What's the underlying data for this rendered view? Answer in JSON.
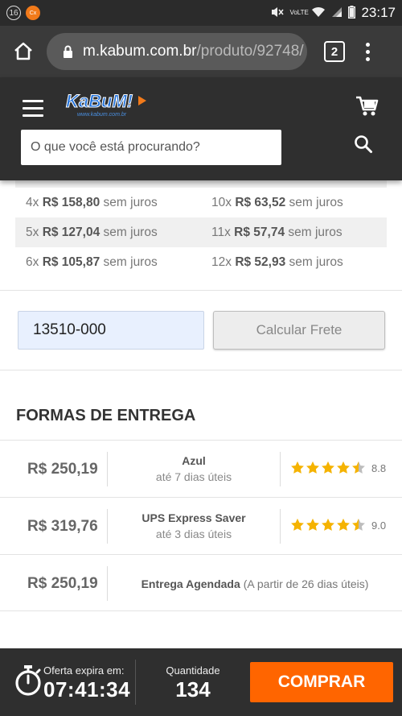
{
  "status_bar": {
    "notification_count": "16",
    "app_badge": "Cx",
    "network_label": "VoLTE",
    "time": "23:17"
  },
  "browser": {
    "url_host": "m.kabum.com.br",
    "url_path": "/produto/92748/",
    "tab_count": "2"
  },
  "header": {
    "logo_text": "KaBuM!",
    "logo_sub": "www.kabum.com.br",
    "search_placeholder": "O que você está procurando?"
  },
  "installments": [
    {
      "left": {
        "n": "4x",
        "price": "R$ 158,80",
        "suffix": "sem juros"
      },
      "right": {
        "n": "10x",
        "price": "R$ 63,52",
        "suffix": "sem juros"
      }
    },
    {
      "left": {
        "n": "5x",
        "price": "R$ 127,04",
        "suffix": "sem juros"
      },
      "right": {
        "n": "11x",
        "price": "R$ 57,74",
        "suffix": "sem juros"
      }
    },
    {
      "left": {
        "n": "6x",
        "price": "R$ 105,87",
        "suffix": "sem juros"
      },
      "right": {
        "n": "12x",
        "price": "R$ 52,93",
        "suffix": "sem juros"
      }
    }
  ],
  "shipping": {
    "cep_value": "13510-000",
    "calc_button": "Calcular Frete"
  },
  "delivery": {
    "title": "FORMAS DE ENTREGA",
    "options": [
      {
        "price": "R$ 250,19",
        "carrier": "Azul",
        "eta": "até 7 dias úteis",
        "stars": 4.5,
        "rating": "8.8"
      },
      {
        "price": "R$ 319,76",
        "carrier": "UPS Express Saver",
        "eta": "até 3 dias úteis",
        "stars": 4.5,
        "rating": "9.0"
      },
      {
        "price": "R$ 250,19",
        "carrier": "Entrega Agendada",
        "note": "(A partir de 26 dias úteis)"
      }
    ]
  },
  "bottom_bar": {
    "offer_label": "Oferta expira em:",
    "offer_time": "07:41:34",
    "qty_label": "Quantidade",
    "qty_value": "134",
    "buy_label": "COMPRAR"
  },
  "colors": {
    "accent": "#ff6500",
    "star": "#f5b301",
    "header_bg": "#2f2f2f"
  }
}
